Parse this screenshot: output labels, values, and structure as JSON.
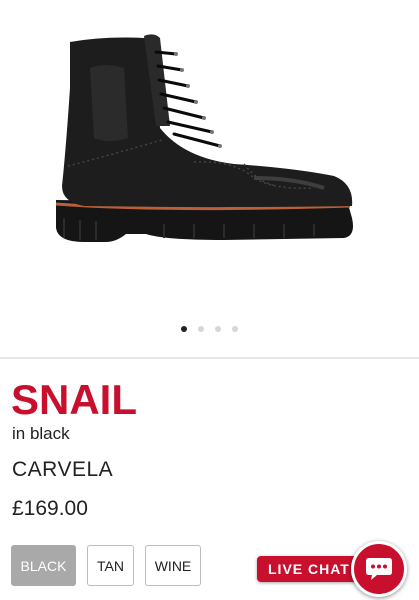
{
  "product": {
    "name": "SNAIL",
    "color_text": "in black",
    "brand": "CARVELA",
    "price": "£169.00"
  },
  "gallery": {
    "image_count": 4,
    "active_index": 0
  },
  "swatches": [
    {
      "label": "BLACK",
      "selected": true
    },
    {
      "label": "TAN",
      "selected": false
    },
    {
      "label": "WINE",
      "selected": false
    }
  ],
  "chat": {
    "label": "LIVE CHAT",
    "icon": "chat-bubble-icon"
  },
  "colors": {
    "brand_red": "#c8102e",
    "selected_swatch": "#a9a9a9"
  }
}
